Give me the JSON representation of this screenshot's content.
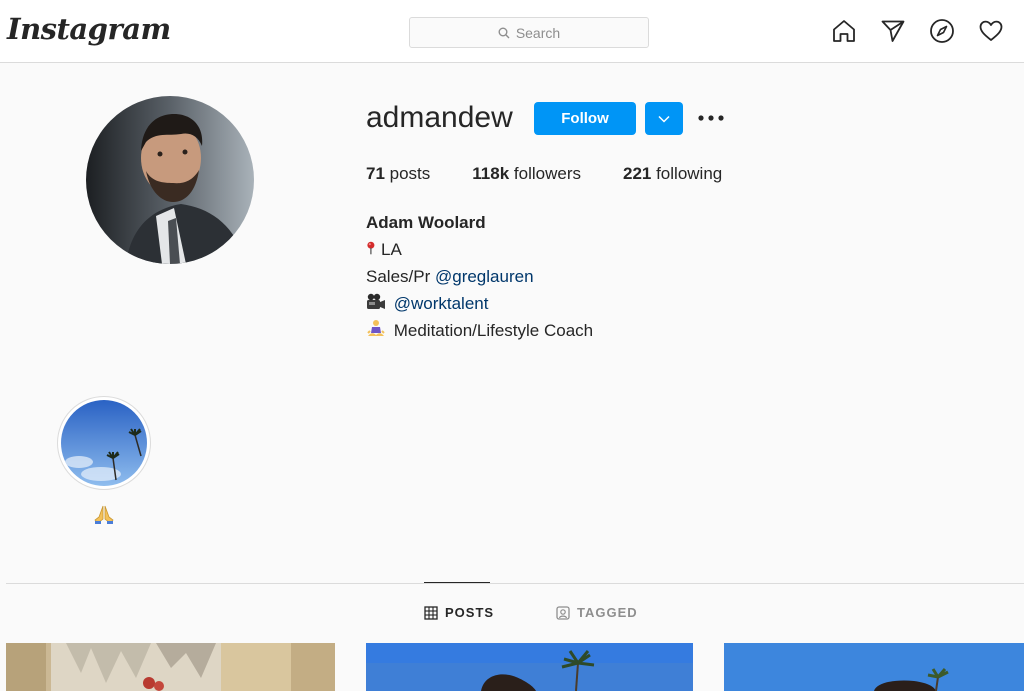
{
  "header": {
    "logo": "Instagram",
    "search_placeholder": "Search",
    "icons": [
      "home-icon",
      "direct-icon",
      "explore-icon",
      "activity-heart-icon"
    ]
  },
  "profile": {
    "username": "admandew",
    "follow_label": "Follow",
    "stats": [
      {
        "count": "71",
        "label": " posts"
      },
      {
        "count": "118k",
        "label": " followers"
      },
      {
        "count": "221",
        "label": " following"
      }
    ],
    "full_name": "Adam Woolard",
    "bio": {
      "line1_text": "LA",
      "line1_icon": "round-pushpin-emoji",
      "line2_prefix": "Sales/Pr ",
      "line2_link": "@greglauren",
      "line3_icon": "movie-camera-emoji",
      "line3_link": "@worktalent",
      "line4_icon": "person-lotus-position-emoji",
      "line4_text": "Meditation/Lifestyle Coach"
    }
  },
  "highlights": [
    {
      "label_icon": "folded-hands-emoji"
    }
  ],
  "tabs": [
    {
      "label": "POSTS",
      "icon": "grid-icon",
      "active": true
    },
    {
      "label": "TAGGED",
      "icon": "tagged-icon",
      "active": false
    }
  ],
  "colors": {
    "accent": "#0095f6",
    "link": "#00376b",
    "border": "#dbdbdb",
    "background": "#fafafa"
  }
}
